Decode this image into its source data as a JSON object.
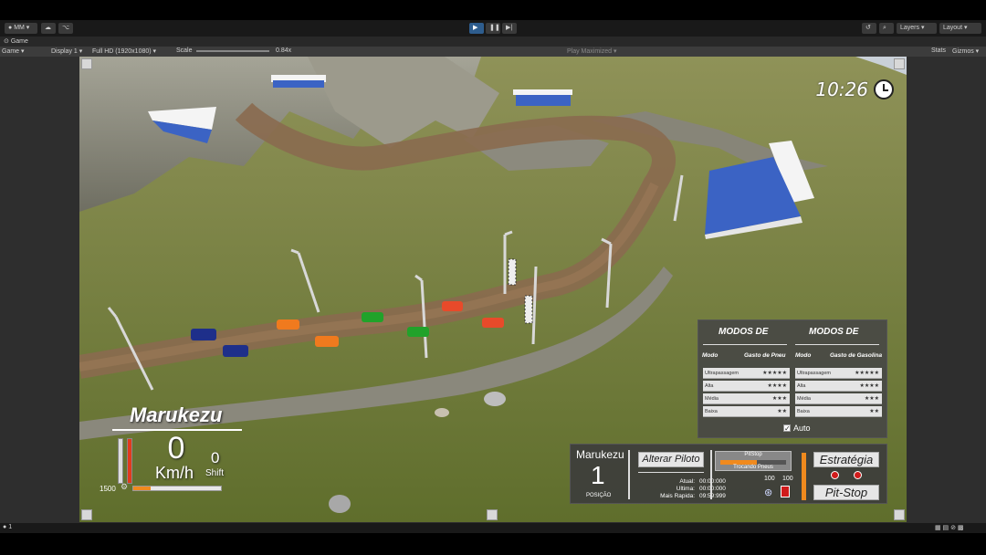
{
  "editor": {
    "account": "MM",
    "layers_label": "Layers",
    "layout_label": "Layout",
    "tab_title": "Game",
    "gamebar": {
      "mode": "Game",
      "display": "Display 1",
      "resolution": "Full HD (1920x1080)",
      "scale_label": "Scale",
      "scale_value": "0.84x",
      "play_option": "Play Maximized",
      "stats": "Stats",
      "gizmos": "Gizmos"
    },
    "status_count": "1"
  },
  "hud": {
    "clock": "10:26",
    "driver": "Marukezu",
    "speed": "0",
    "speed_unit": "Km/h",
    "shift": "0",
    "shift_label": "Shift",
    "rpm": "1500",
    "rpm_fill": 0.2,
    "left_gauges": [
      0.0,
      1.0
    ]
  },
  "modes": {
    "tire_title": "MODOS DE",
    "fuel_title": "MODOS DE",
    "col_mode": "Modo",
    "col_tire": "Gasto de Pneu",
    "col_mode2": "Modo",
    "col_fuel": "Gasto de Gasolina",
    "tire_rows": [
      {
        "label": "Ultrapassagem",
        "stars": "★★★★★"
      },
      {
        "label": "Alta",
        "stars": "★★★★"
      },
      {
        "label": "Média",
        "stars": "★★★"
      },
      {
        "label": "Baixa",
        "stars": "★★"
      }
    ],
    "fuel_rows": [
      {
        "label": "Ultrapassagem",
        "stars": "★★★★★"
      },
      {
        "label": "Alta",
        "stars": "★★★★"
      },
      {
        "label": "Média",
        "stars": "★★★"
      },
      {
        "label": "Baixa",
        "stars": "★★"
      }
    ],
    "auto_label": "Auto"
  },
  "race": {
    "driver": "Marukezu",
    "position": "1",
    "position_label": "POSIÇÃO",
    "change_driver": "Alterar Piloto",
    "times_labels": [
      "Atual:",
      "Ultima:",
      "Mais Rapida:"
    ],
    "times_values": [
      "00:00:000",
      "00:00:000",
      "09:59:999"
    ],
    "pit_title": "PitStop",
    "pit_status": "Trocando Pneus",
    "pit_fill": 0.55,
    "tire_value": "100",
    "fuel_value": "100",
    "fuel_fill": 1.0,
    "strategy": "Estratégia",
    "pitstop": "Pit-Stop"
  },
  "colors": {
    "accent_orange": "#f08a1e",
    "red": "#d01b1b",
    "play_blue": "#2e5d8e"
  }
}
